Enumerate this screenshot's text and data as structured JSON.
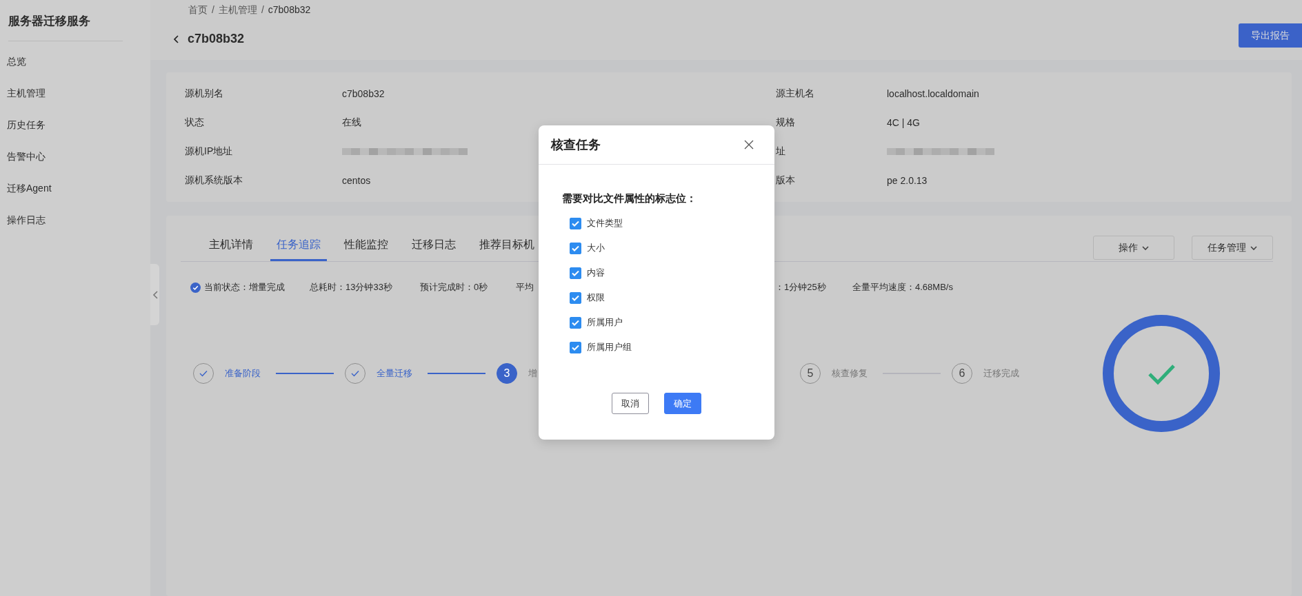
{
  "sidebar": {
    "title": "服务器迁移服务",
    "items": [
      "总览",
      "主机管理",
      "历史任务",
      "告警中心",
      "迁移Agent",
      "操作日志"
    ]
  },
  "header": {
    "breadcrumb": {
      "items": [
        "首页",
        "主机管理",
        "c7b08b32"
      ],
      "separator": "/"
    },
    "title": "c7b08b32",
    "export_button": "导出报告"
  },
  "info": {
    "fields": [
      {
        "label": "源机别名",
        "value": "c7b08b32"
      },
      {
        "label": "源主机名",
        "value": "localhost.localdomain"
      },
      {
        "label": "状态",
        "value": "在线"
      },
      {
        "label": "规格",
        "value": "4C | 4G"
      },
      {
        "label": "源机IP地址",
        "kind": "redacted"
      },
      {
        "label": "址",
        "kind": "redacted"
      },
      {
        "label": "源机系统版本",
        "value": "centos"
      },
      {
        "label": "版本",
        "value": "pe 2.0.13"
      }
    ]
  },
  "tabs": [
    {
      "label": "主机详情",
      "selected": false
    },
    {
      "label": "任务追踪",
      "selected": true
    },
    {
      "label": "性能监控",
      "selected": false
    },
    {
      "label": "迁移日志",
      "selected": false
    },
    {
      "label": "推荐目标机",
      "selected": false
    }
  ],
  "actions": [
    "操作",
    "任务管理"
  ],
  "status_items": [
    {
      "text": "当前状态：增量完成",
      "kind": "current"
    },
    {
      "text": "总耗时：13分钟33秒",
      "kind": "plain"
    },
    {
      "text": "预计完成时：0秒",
      "kind": "plain"
    },
    {
      "text": "平均",
      "kind": "plain"
    },
    {
      "text": "：1分钟25秒",
      "kind": "plain"
    },
    {
      "text": "全量平均速度：4.68MB/s",
      "kind": "plain"
    }
  ],
  "steps": [
    {
      "label": "准备阶段",
      "kind": "done"
    },
    {
      "label": "全量迁移",
      "kind": "done"
    },
    {
      "number": "3",
      "label": "增",
      "kind": "active"
    },
    {
      "number": "5",
      "label": "核查修复",
      "kind": "pending"
    },
    {
      "number": "6",
      "label": "迁移完成",
      "kind": "pending"
    }
  ],
  "modal": {
    "title": "核查任务",
    "prompt": "需要对比文件属性的标志位：",
    "options": [
      {
        "label": "文件类型",
        "checked": true
      },
      {
        "label": "大小",
        "checked": true
      },
      {
        "label": "内容",
        "checked": true
      },
      {
        "label": "权限",
        "checked": true
      },
      {
        "label": "所属用户",
        "checked": true
      },
      {
        "label": "所属用户组",
        "checked": true
      }
    ],
    "buttons": [
      {
        "label": "取消",
        "kind": "secondary"
      },
      {
        "label": "确定",
        "kind": "primary"
      }
    ]
  }
}
